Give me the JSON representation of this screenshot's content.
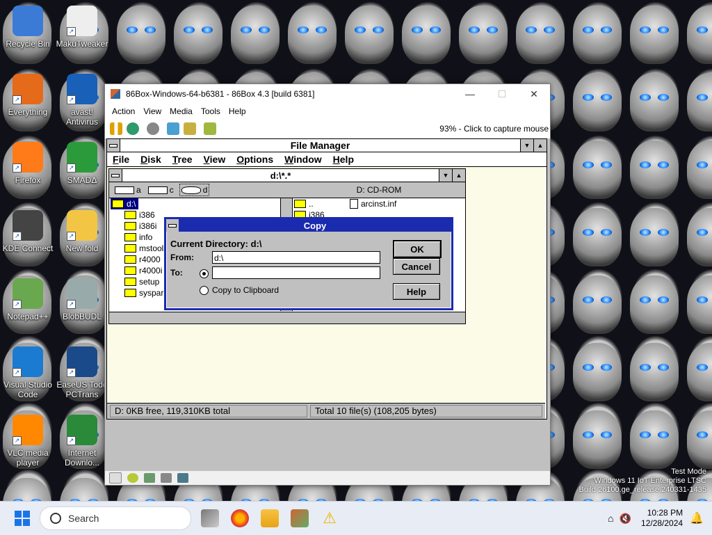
{
  "desktop": {
    "icons": [
      {
        "label": "Recycle Bin"
      },
      {
        "label": "MakuTweaker"
      },
      {
        "label": "Everything"
      },
      {
        "label": "avast! Antivirus"
      },
      {
        "label": "Firefox"
      },
      {
        "label": "SMADΔ"
      },
      {
        "label": "KDE Connect"
      },
      {
        "label": "New fold"
      },
      {
        "label": "Notepad++"
      },
      {
        "label": "BlobBUDL"
      },
      {
        "label": "Visual Studio Code"
      },
      {
        "label": "EaseUS Todo PCTrans"
      },
      {
        "label": "VLC media player"
      },
      {
        "label": "Internet Downlo..."
      }
    ],
    "watermark": {
      "line1": "Test Mode",
      "line2": "Windows 11 IoT Enterprise LTSC",
      "line3": "Build 26100.ge_release.240331-1435"
    }
  },
  "emulator": {
    "title": "86Box-Windows-64-b6381 - 86Box 4.3 [build 6381]",
    "menu": [
      "Action",
      "View",
      "Media",
      "Tools",
      "Help"
    ],
    "status_text": "93% - Click to capture mouse"
  },
  "file_manager": {
    "title": "File Manager",
    "menu": [
      {
        "label": "File",
        "u": "F"
      },
      {
        "label": "Disk",
        "u": "D"
      },
      {
        "label": "Tree",
        "u": "T"
      },
      {
        "label": "View",
        "u": "V"
      },
      {
        "label": "Options",
        "u": "O"
      },
      {
        "label": "Window",
        "u": "W"
      },
      {
        "label": "Help",
        "u": "H"
      }
    ],
    "child_title": "d:\\*.*",
    "drives": [
      "a",
      "c",
      "d"
    ],
    "drive_label": "D: CD-ROM",
    "tree": [
      "d:\\",
      "i386",
      "i386i",
      "info",
      "mstools",
      "r4000",
      "r4000i",
      "setup",
      "sysparl"
    ],
    "files": [
      "..",
      "i386",
      "arcinst.inf"
    ],
    "status_left": "D: 0KB free,  119,310KB total",
    "status_right": "Total 10 file(s) (108,205 bytes)"
  },
  "copy_dialog": {
    "title": "Copy",
    "current_dir_label": "Current Directory: d:\\",
    "from_label": "From:",
    "from_value": "d:\\",
    "to_label": "To:",
    "to_value": "",
    "clipboard_label": "Copy to Clipboard",
    "ok": "OK",
    "cancel": "Cancel",
    "help": "Help"
  },
  "taskbar": {
    "search_placeholder": "Search",
    "time": "10:28 PM",
    "date": "12/28/2024"
  }
}
